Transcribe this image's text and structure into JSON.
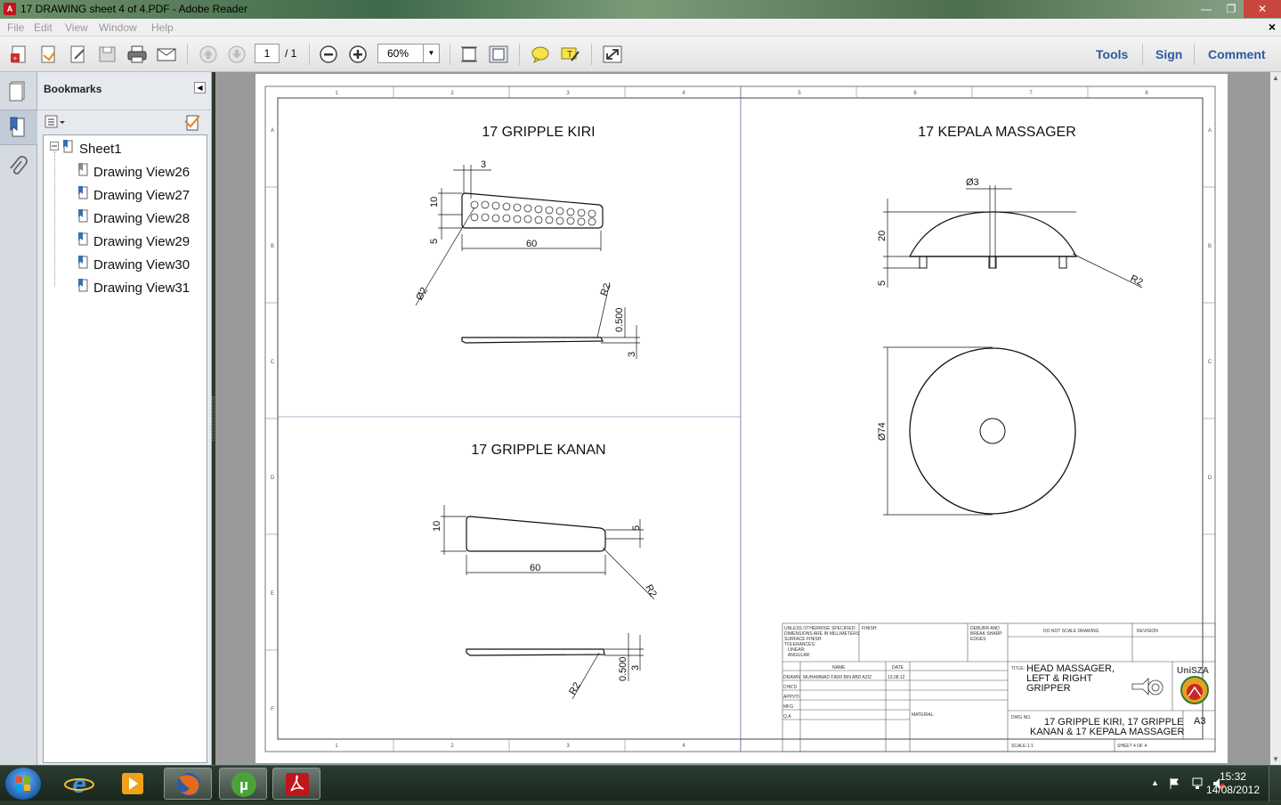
{
  "window": {
    "title": "17 DRAWING sheet 4 of 4.PDF - Adobe Reader",
    "minimize": "—",
    "maximize": "❐",
    "close": "✕"
  },
  "menu": {
    "items": [
      "File",
      "Edit",
      "View",
      "Window",
      "Help"
    ],
    "doc_close": "×"
  },
  "toolbar": {
    "page_current": "1",
    "page_total": "/ 1",
    "zoom": "60%",
    "tools": "Tools",
    "sign": "Sign",
    "comment": "Comment"
  },
  "bookmarks": {
    "header": "Bookmarks",
    "root": "Sheet1",
    "items": [
      "Drawing View26",
      "Drawing View27",
      "Drawing View28",
      "Drawing View29",
      "Drawing View30",
      "Drawing View31"
    ]
  },
  "drawing": {
    "col_labels": [
      "1",
      "2",
      "3",
      "4",
      "5",
      "6",
      "7",
      "8"
    ],
    "row_labels": [
      "A",
      "B",
      "C",
      "D",
      "E",
      "F"
    ],
    "view1": {
      "title": "17 GRIPPLE KIRI",
      "dims": {
        "d3": "3",
        "d10": "10",
        "d5": "5",
        "d60": "60",
        "dia2": "Ø2",
        "r2": "R2",
        "d0500": "0.500",
        "d3b": "3"
      }
    },
    "view2": {
      "title": "17 GRIPPLE KANAN",
      "dims": {
        "d10": "10",
        "d5": "5",
        "d60": "60",
        "r2": "R2",
        "r2b": "R2",
        "d0500": "0.500",
        "d3": "3"
      }
    },
    "view3": {
      "title": "17 KEPALA MASSAGER",
      "dims": {
        "dia3": "Ø3",
        "d20": "20",
        "d5": "5",
        "r2": "R2",
        "dia74": "Ø74"
      }
    },
    "title_block": {
      "general_notes": [
        "UNLESS OTHERWISE SPECIFIED:",
        "DIMENSIONS ARE IN MILLIMETERS",
        "SURFACE FINISH:",
        "TOLERANCES:",
        "LINEAR:",
        "ANGULAR:"
      ],
      "finish": "FINISH:",
      "deburr": [
        "DEBURR AND",
        "BREAK SHARP",
        "EDGES"
      ],
      "do_not_scale": "DO NOT SCALE DRAWING",
      "revision": "REVISION",
      "name_hdr": "NAME",
      "date_hdr": "DATE",
      "roles": [
        "DRAWN",
        "CHK'D",
        "APPV'D",
        "MFG",
        "Q.A"
      ],
      "drawn_name": "MUHAMMAD FIKRI BIN ABD AZIZ",
      "drawn_date": "13.08.12",
      "material": "MATERIAL:",
      "title_label": "TITLE:",
      "title_lines": [
        "HEAD MASSAGER,",
        "LEFT & RIGHT",
        "GRIPPER"
      ],
      "logo_text": "UniSZA",
      "dwg_label": "DWG NO.",
      "dwg_lines": [
        "17 GRIPPLE KIRI, 17 GRIPPLE",
        "KANAN & 17 KEPALA MASSAGER"
      ],
      "size": "A3",
      "scale": "SCALE:1:1",
      "sheet": "SHEET 4 OF 4"
    }
  },
  "taskbar": {
    "time": "15:32",
    "date": "14/08/2012"
  }
}
